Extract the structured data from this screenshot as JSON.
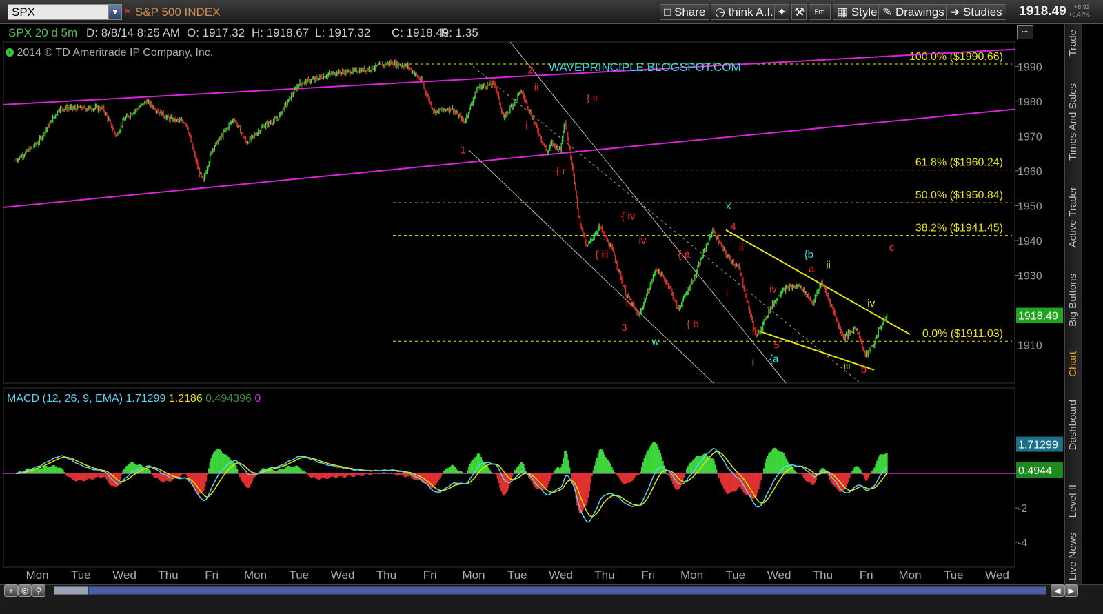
{
  "toolbar": {
    "symbol": "SPX",
    "symbol_name": "S&P 500 INDEX",
    "buttons": [
      "Share",
      "think A.I.",
      "5m",
      "Style",
      "Drawings",
      "Studies"
    ],
    "last_price": "1918.49",
    "change": "+8.92",
    "change_pct": "+0.47%"
  },
  "infobar": {
    "symbol_period": "SPX 20 d 5m",
    "date": "D: 8/8/14 8:25 AM",
    "open": "O: 1917.32",
    "high": "H: 1918.67",
    "low": "L: 1917.32",
    "close": "C: 1918.49",
    "range": "R: 1.35"
  },
  "copyright": "2014 © TD Ameritrade IP Company, Inc.",
  "watermark": "WAVEPRINCIPLE.BLOGSPOT.COM",
  "sidebar_tabs": [
    "Trade",
    "Times And Sales",
    "Active Trader",
    "Big Buttons",
    "Chart",
    "Dashboard",
    "Level II",
    "Live News"
  ],
  "colors": {
    "up": "#3dd63d",
    "down": "#e03030",
    "fib": "#e6e600",
    "magenta": "#dd22dd",
    "wave_red": "#ff2a2a",
    "wave_cyan": "#33e6e6",
    "wave_yellow": "#f0f000",
    "macd_line": "#5fd3f5",
    "signal_line": "#e6e600"
  },
  "chart_data": [
    {
      "type": "line",
      "title": "SPX 20 d 5m",
      "x_labels": [
        "Mon",
        "Tue",
        "Wed",
        "Thu",
        "Fri",
        "Mon",
        "Tue",
        "Wed",
        "Thu",
        "Fri",
        "Mon",
        "Tue",
        "Wed",
        "Thu",
        "Fri",
        "Mon",
        "Tue",
        "Wed",
        "Thu",
        "Fri",
        "Mon",
        "Tue",
        "Wed"
      ],
      "y_ticks": [
        1990,
        1980,
        1970,
        1960,
        1950,
        1940,
        1930,
        1910
      ],
      "ylim": [
        1899,
        1997
      ],
      "price_path": [
        [
          0,
          1963
        ],
        [
          0.5,
          1968
        ],
        [
          1,
          1978
        ],
        [
          2,
          1978
        ],
        [
          2.3,
          1970
        ],
        [
          2.5,
          1975
        ],
        [
          3,
          1980
        ],
        [
          3.5,
          1975
        ],
        [
          3.9,
          1974
        ],
        [
          4.2,
          1960
        ],
        [
          4.3,
          1957
        ],
        [
          4.5,
          1966
        ],
        [
          5,
          1975
        ],
        [
          5.3,
          1968
        ],
        [
          5.7,
          1973
        ],
        [
          6,
          1975
        ],
        [
          6.5,
          1985
        ],
        [
          7.3,
          1988
        ],
        [
          8,
          1989
        ],
        [
          8.6,
          1991
        ],
        [
          9,
          1990
        ],
        [
          9.3,
          1986
        ],
        [
          9.6,
          1977
        ],
        [
          10,
          1978
        ],
        [
          10.3,
          1974
        ],
        [
          10.6,
          1984
        ],
        [
          11,
          1985
        ],
        [
          11.2,
          1975
        ],
        [
          11.6,
          1983
        ],
        [
          11.8,
          1977
        ],
        [
          12.2,
          1965
        ],
        [
          12.3,
          1968
        ],
        [
          12.5,
          1966
        ],
        [
          12.6,
          1975
        ],
        [
          12.7,
          1967
        ],
        [
          12.8,
          1960
        ],
        [
          12.9,
          1948
        ],
        [
          13.1,
          1938
        ],
        [
          13.4,
          1944
        ],
        [
          13.7,
          1937
        ],
        [
          14,
          1925
        ],
        [
          14.3,
          1918
        ],
        [
          14.7,
          1932
        ],
        [
          15,
          1927
        ],
        [
          15.2,
          1920
        ],
        [
          15.6,
          1930
        ],
        [
          15.8,
          1937
        ],
        [
          16,
          1943
        ],
        [
          16.3,
          1936
        ],
        [
          16.6,
          1932
        ],
        [
          17,
          1912
        ],
        [
          17.3,
          1920
        ],
        [
          17.6,
          1926
        ],
        [
          18,
          1927
        ],
        [
          18.3,
          1922
        ],
        [
          18.5,
          1928
        ],
        [
          18.7,
          1922
        ],
        [
          19,
          1912
        ],
        [
          19.3,
          1915
        ],
        [
          19.5,
          1907
        ],
        [
          19.7,
          1910
        ],
        [
          19.8,
          1914
        ],
        [
          20,
          1918.49
        ]
      ],
      "fib_levels": [
        {
          "label": "100.0%",
          "value": "($1990.66)",
          "price": 1990.66
        },
        {
          "label": "61.8%",
          "value": "($1960.24)",
          "price": 1960.24
        },
        {
          "label": "50.0%",
          "value": "($1950.84)",
          "price": 1950.84
        },
        {
          "label": "38.2%",
          "value": "($1941.45)",
          "price": 1941.45
        },
        {
          "label": "0.0%",
          "value": "($1911.03)",
          "price": 1911.03
        }
      ],
      "last_price_label": "1918.49",
      "wave_labels": [
        {
          "text": "2",
          "color": "red",
          "x": 11.75,
          "y": 1988
        },
        {
          "text": "ii",
          "color": "red",
          "x": 11.9,
          "y": 1983
        },
        {
          "text": "{ ii",
          "color": "red",
          "x": 13.1,
          "y": 1980
        },
        {
          "text": "i",
          "color": "red",
          "x": 11.7,
          "y": 1972
        },
        {
          "text": "1",
          "color": "red",
          "x": 10.2,
          "y": 1965
        },
        {
          "text": "{ i",
          "color": "red",
          "x": 12.4,
          "y": 1959
        },
        {
          "text": "{ iv",
          "color": "red",
          "x": 13.9,
          "y": 1946
        },
        {
          "text": "iv",
          "color": "red",
          "x": 14.3,
          "y": 1939
        },
        {
          "text": "{ iii",
          "color": "red",
          "x": 13.3,
          "y": 1935
        },
        {
          "text": "iii",
          "color": "red",
          "x": 14,
          "y": 1921
        },
        {
          "text": "3",
          "color": "red",
          "x": 13.9,
          "y": 1914
        },
        {
          "text": "w",
          "color": "cyan",
          "x": 14.6,
          "y": 1910
        },
        {
          "text": "{ a",
          "color": "red",
          "x": 15.2,
          "y": 1935
        },
        {
          "text": "{ b",
          "color": "red",
          "x": 15.4,
          "y": 1915
        },
        {
          "text": "x",
          "color": "cyan",
          "x": 16.3,
          "y": 1949
        },
        {
          "text": "4",
          "color": "red",
          "x": 16.4,
          "y": 1943
        },
        {
          "text": "ii",
          "color": "red",
          "x": 16.6,
          "y": 1937
        },
        {
          "text": "i",
          "color": "red",
          "x": 16.3,
          "y": 1924
        },
        {
          "text": "iv",
          "color": "red",
          "x": 17.3,
          "y": 1925
        },
        {
          "text": "iii",
          "color": "red",
          "x": 16.9,
          "y": 1913
        },
        {
          "text": "5",
          "color": "red",
          "x": 17.4,
          "y": 1909
        },
        {
          "text": "{a",
          "color": "cyan",
          "x": 17.3,
          "y": 1905
        },
        {
          "text": "i",
          "color": "yellow",
          "x": 16.9,
          "y": 1904
        },
        {
          "text": "{b",
          "color": "cyan",
          "x": 18.1,
          "y": 1935
        },
        {
          "text": "ii",
          "color": "yellow",
          "x": 18.6,
          "y": 1932
        },
        {
          "text": "a",
          "color": "red",
          "x": 18.2,
          "y": 1931
        },
        {
          "text": "iv",
          "color": "yellow",
          "x": 19.55,
          "y": 1921
        },
        {
          "text": "iii",
          "color": "yellow",
          "x": 19.0,
          "y": 1903
        },
        {
          "text": "b",
          "color": "red",
          "x": 19.4,
          "y": 1902
        },
        {
          "text": "c",
          "color": "red",
          "x": 20.05,
          "y": 1937
        }
      ]
    },
    {
      "type": "line",
      "title": "MACD (12, 26, 9, EMA)",
      "values": {
        "macd": "1.71299",
        "signal": "1.2186",
        "hist": "0.494396",
        "zero": "0"
      },
      "right_labels": [
        "1.71299",
        "0.4944"
      ],
      "y_ticks": [
        0,
        -2,
        -4
      ],
      "ylim": [
        -5.4,
        3.9
      ],
      "x_labels": [
        "Mon",
        "Tue",
        "Wed",
        "Thu",
        "Fri",
        "Mon",
        "Tue",
        "Wed",
        "Thu",
        "Fri",
        "Mon",
        "Tue",
        "Wed",
        "Thu",
        "Fri",
        "Mon",
        "Tue",
        "Wed",
        "Thu",
        "Fri",
        "Mon",
        "Tue",
        "Wed"
      ]
    }
  ]
}
